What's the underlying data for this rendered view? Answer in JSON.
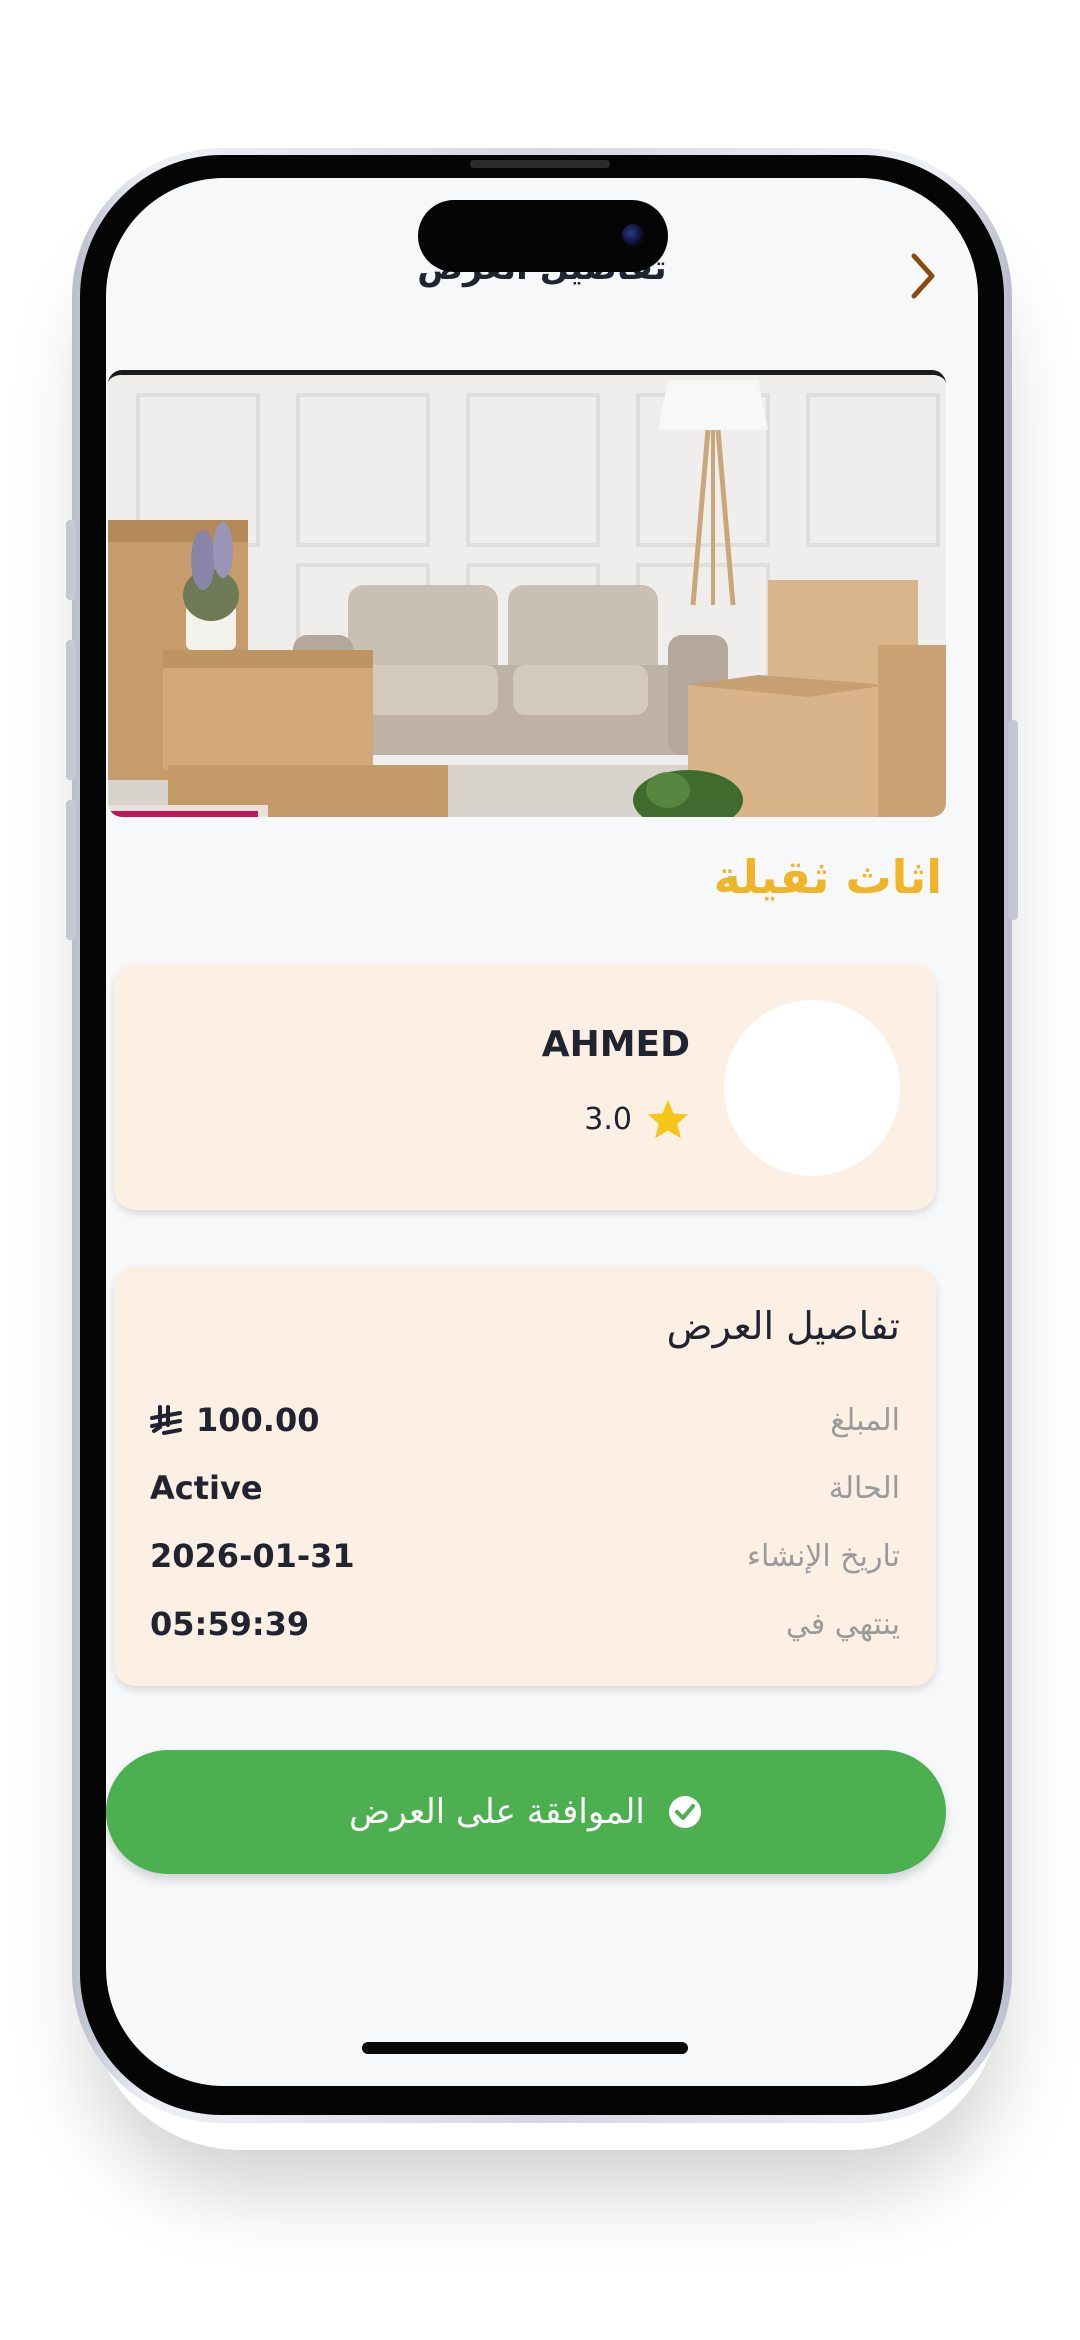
{
  "header": {
    "title": "تفاصيل العرض"
  },
  "category": {
    "title": "اثاث ثقيلة"
  },
  "provider": {
    "name": "AHMED",
    "rating": "3.0"
  },
  "details": {
    "title": "تفاصيل العرض",
    "rows": [
      {
        "label": "المبلغ",
        "value": "100.00",
        "currency": "⃁"
      },
      {
        "label": "الحالة",
        "value": "Active"
      },
      {
        "label": "تاريخ الإنشاء",
        "value": "2026-01-31"
      },
      {
        "label": "ينتهي في",
        "value": "05:59:39"
      }
    ]
  },
  "actions": {
    "accept_label": "الموافقة على العرض"
  },
  "colors": {
    "accent_yellow": "#f0b429",
    "card_bg": "#fcefe4",
    "accept_green": "#4caf50",
    "back_arrow": "#8a4a0f",
    "star": "#f5c518"
  },
  "icons": {
    "back": "chevron-right-icon",
    "star": "star-icon",
    "check": "check-circle-icon",
    "currency": "riyal-icon"
  }
}
